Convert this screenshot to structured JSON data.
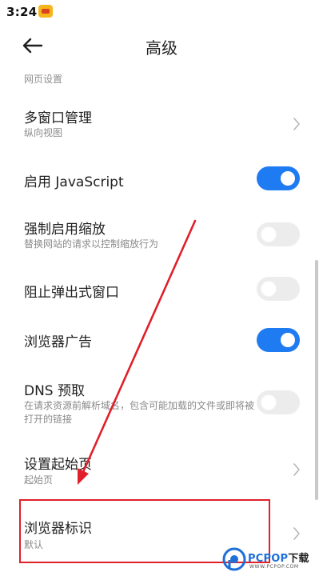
{
  "status_bar": {
    "time": "3:24",
    "app_icon": "notification-app-icon"
  },
  "header": {
    "title": "高级",
    "back_icon": "arrow-left-icon"
  },
  "section": {
    "title": "网页设置"
  },
  "rows": [
    {
      "title": "多窗口管理",
      "subtitle": "纵向视图",
      "control": "chevron"
    },
    {
      "title": "启用 JavaScript",
      "control": "toggle",
      "on": true
    },
    {
      "title": "强制启用缩放",
      "subtitle": "替换网站的请求以控制缩放行为",
      "control": "toggle",
      "on": false
    },
    {
      "title": "阻止弹出式窗口",
      "control": "toggle",
      "on": false
    },
    {
      "title": "浏览器广告",
      "control": "toggle",
      "on": true
    },
    {
      "title": "DNS 预取",
      "subtitle": "在请求资源前解析域名，包含可能加载的文件或即将被打开的链接",
      "control": "toggle",
      "on": false
    },
    {
      "title": "设置起始页",
      "subtitle": "起始页",
      "control": "chevron"
    },
    {
      "title": "浏览器标识",
      "subtitle": "默认",
      "control": "chevron"
    }
  ],
  "colors": {
    "toggle_on": "#1f7bf2",
    "toggle_off": "#ececec",
    "annotation": "#e0202a"
  },
  "watermark": {
    "brand": "PCPOP",
    "download": "下载",
    "url": "WWW.PCPOP.COM"
  }
}
